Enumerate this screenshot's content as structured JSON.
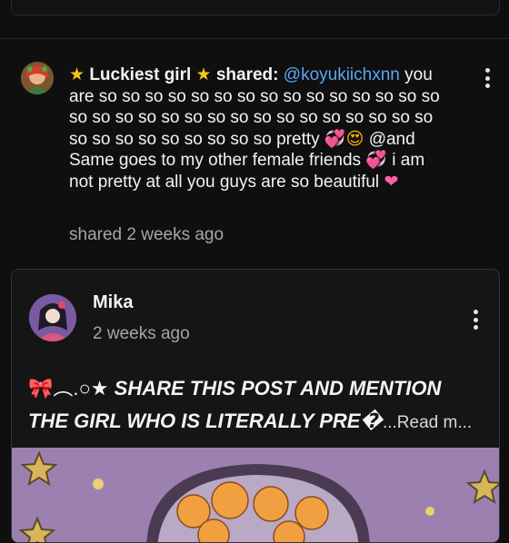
{
  "share": {
    "author": "Luckiest girl",
    "verb": "shared:",
    "mention": "@koyukiichxnn",
    "text_part1": "you are so so so so so so so so so so so so so so so so so so so so so so so so so so so so so so so so so so so so so so so so pretty",
    "text_part2": "@and Same goes to my other female friends",
    "text_part3": "i am not pretty at all you guys are so beautiful",
    "time": "shared 2 weeks ago"
  },
  "post": {
    "author": "Mika",
    "time": "2 weeks ago",
    "body_deco": "︵.○★",
    "body_line1": "SHARE THIS POST AND MENTION",
    "body_line2": "THE GIRL WHO IS LITERALLY PRE�",
    "read_more": "...Read m..."
  },
  "icons": {
    "more": "more-vertical-icon",
    "star": "star-icon",
    "heart": "heart-icon",
    "bow": "ribbon-icon"
  },
  "colors": {
    "background": "#0f0f10",
    "mention": "#5aa6f0",
    "muted_text": "#a6a6a6"
  }
}
